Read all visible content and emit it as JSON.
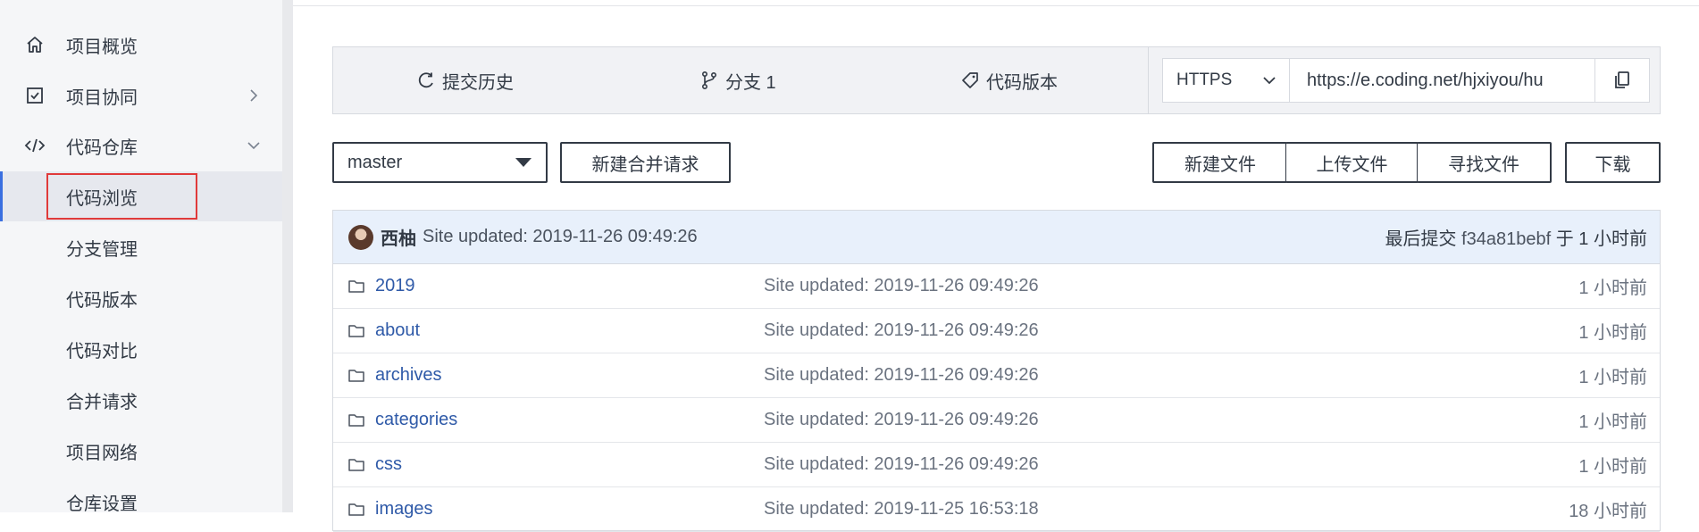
{
  "sidebar": {
    "items": [
      {
        "label": "项目概览",
        "icon": "home-icon"
      },
      {
        "label": "项目协同",
        "icon": "checkbox-icon"
      },
      {
        "label": "代码仓库",
        "icon": "code-icon"
      },
      {
        "label": "代码浏览"
      },
      {
        "label": "分支管理"
      },
      {
        "label": "代码版本"
      },
      {
        "label": "代码对比"
      },
      {
        "label": "合并请求"
      },
      {
        "label": "项目网络"
      },
      {
        "label": "仓库设置"
      }
    ]
  },
  "toolbar": {
    "history_label": "提交历史",
    "branches_label": "分支 1",
    "tags_label": "代码版本",
    "protocol": "HTTPS",
    "clone_url": "https://e.coding.net/hjxiyou/hu"
  },
  "actions": {
    "branch": "master",
    "new_merge_request": "新建合并请求",
    "new_file": "新建文件",
    "upload_file": "上传文件",
    "find_file": "寻找文件",
    "download": "下载"
  },
  "commit": {
    "author": "西柚",
    "message": "Site updated: 2019-11-26 09:49:26",
    "last_commit_prefix": "最后提交",
    "hash": "f34a81bebf",
    "time_text": "于 1 小时前"
  },
  "files": [
    {
      "name": "2019",
      "message": "Site updated: 2019-11-26 09:49:26",
      "time": "1 小时前"
    },
    {
      "name": "about",
      "message": "Site updated: 2019-11-26 09:49:26",
      "time": "1 小时前"
    },
    {
      "name": "archives",
      "message": "Site updated: 2019-11-26 09:49:26",
      "time": "1 小时前"
    },
    {
      "name": "categories",
      "message": "Site updated: 2019-11-26 09:49:26",
      "time": "1 小时前"
    },
    {
      "name": "css",
      "message": "Site updated: 2019-11-26 09:49:26",
      "time": "1 小时前"
    },
    {
      "name": "images",
      "message": "Site updated: 2019-11-25 16:53:18",
      "time": "18 小时前"
    }
  ],
  "colors": {
    "accent": "#3a6fe0",
    "highlight": "#e03a3a",
    "link": "#2f5aa8"
  }
}
